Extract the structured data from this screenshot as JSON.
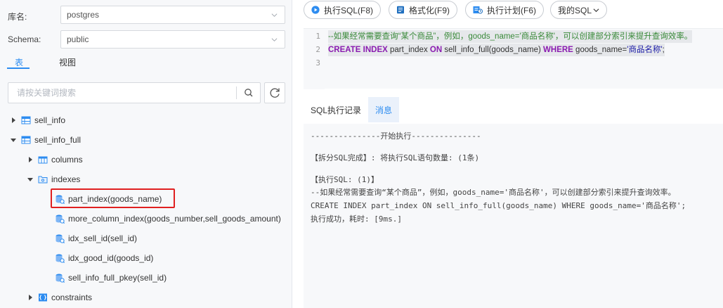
{
  "db_panel": {
    "db_label": "库名:",
    "db_value": "postgres",
    "schema_label": "Schema:",
    "schema_value": "public",
    "tabs": [
      "表",
      "视图"
    ],
    "search_placeholder": "请按关键词搜索"
  },
  "tree": {
    "sell_info": "sell_info",
    "sell_info_full": "sell_info_full",
    "columns": "columns",
    "indexes": "indexes",
    "index_items": [
      "part_index(goods_name)",
      "more_column_index(goods_number,sell_goods_amount)",
      "idx_sell_id(sell_id)",
      "idx_good_id(goods_id)",
      "sell_info_full_pkey(sell_id)"
    ],
    "constraints": "constraints"
  },
  "toolbar": {
    "execute": "执行SQL(F8)",
    "format": "格式化(F9)",
    "plan": "执行计划(F6)",
    "my_sql": "我的SQL"
  },
  "editor": {
    "line_numbers": [
      "1",
      "2",
      "3"
    ],
    "comment": "--如果经常需要查询“某个商品”，例如，goods_name='商品名称'，可以创建部分索引来提升查询效率。",
    "sql": {
      "kw_create": "CREATE",
      "kw_index": "INDEX",
      "index_name": "part_index",
      "kw_on": "ON",
      "table_call": "sell_info_full(goods_name)",
      "kw_where": "WHERE",
      "cond": "goods_name=",
      "literal": "'商品名称'",
      "end": ";"
    }
  },
  "result_tabs": [
    "SQL执行记录",
    "消息"
  ],
  "messages": [
    "---------------开始执行---------------",
    "【拆分SQL完成】: 将执行SQL语句数量: (1条)",
    "【执行SQL: (1)】",
    "--如果经常需要查询“某个商品”，例如，goods_name='商品名称'，可以创建部分索引来提升查询效率。",
    "CREATE INDEX part_index ON sell_info_full(goods_name) WHERE goods_name='商品名称';",
    "执行成功，耗时: [9ms.]"
  ],
  "colors": {
    "accent": "#2d8cf0",
    "highlight": "#e02020",
    "keyword": "#8a1bb0",
    "comment": "#3a8a3a"
  }
}
